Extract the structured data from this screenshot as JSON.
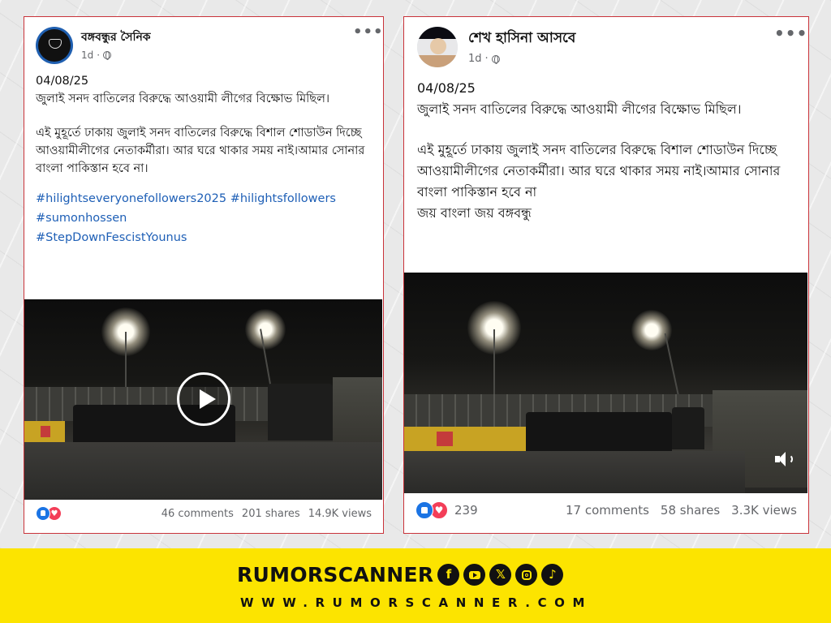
{
  "post1": {
    "page_name": "বঙ্গবন্ধুর সৈনিক",
    "time": "1d",
    "date": "04/08/25",
    "title_line": "জুলাই সনদ বাতিলের বিরুদ্ধে আওয়ামী লীগের বিক্ষোভ মিছিল।",
    "body": "এই মুহূর্তে ঢাকায় জুলাই সনদ বাতিলের বিরুদ্ধে বিশাল শোডাউন দিচ্ছে আওয়ামীলীগের নেতাকর্মীরা। আর ঘরে থাকার সময় নাই।আমার সোনার বাংলা পাকিস্তান হবে না।",
    "hashtags": [
      "#hilightseveryonefollowers2025 #hilightsfollowers",
      "#sumonhossen",
      "#StepDownFescistYounus"
    ],
    "comments": "46 comments",
    "shares": "201 shares",
    "views": "14.9K views",
    "video_control": "play-icon"
  },
  "post2": {
    "page_name": "শেখ হাসিনা আসবে",
    "time": "1d",
    "date": "04/08/25",
    "title_line": "জুলাই সনদ বাতিলের বিরুদ্ধে আওয়ামী লীগের বিক্ষোভ মিছিল।",
    "body": "এই মুহূর্তে ঢাকায় জুলাই সনদ বাতিলের বিরুদ্ধে বিশাল শোডাউন দিচ্ছে আওয়ামীলীগের নেতাকর্মীরা। আর ঘরে থাকার সময় নাই।আমার সোনার বাংলা পাকিস্তান হবে না",
    "closing": "জয় বাংলা জয় বঙ্গবন্ধু",
    "reactions": "239",
    "comments": "17 comments",
    "shares": "58 shares",
    "views": "3.3K views",
    "video_control": "speaker-icon"
  },
  "footer": {
    "brand": "RUMORSCANNER",
    "website": "WWW.RUMORSCANNER.COM",
    "social_icons": [
      "facebook-icon",
      "youtube-icon",
      "x-icon",
      "instagram-icon",
      "tiktok-icon"
    ],
    "background_color": "#fce400"
  },
  "colors": {
    "card_border": "#c9333a",
    "hashtag": "#1e5fb6",
    "like": "#1b74e4",
    "love": "#f33e58"
  }
}
